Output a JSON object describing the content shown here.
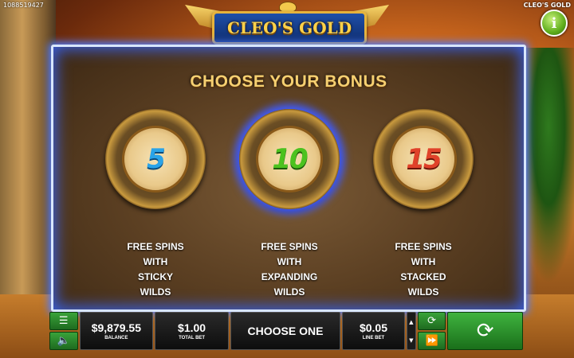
{
  "header": {
    "session_id": "1088519427",
    "game_name": "CLEO'S GOLD",
    "logo_text": "CLEO'S GOLD",
    "info_icon": "info-icon"
  },
  "bonus": {
    "title": "CHOOSE YOUR BONUS",
    "options": [
      {
        "spins": "5",
        "description": "FREE SPINS\nWITH\nSTICKY\nWILDS",
        "color": "#2aa3e8",
        "selected": false
      },
      {
        "spins": "10",
        "description": "FREE SPINS\nWITH\nEXPANDING\nWILDS",
        "color": "#4cc21f",
        "selected": true
      },
      {
        "spins": "15",
        "description": "FREE SPINS\nWITH\nSTACKED\nWILDS",
        "color": "#e0422a",
        "selected": false
      }
    ]
  },
  "bottom_bar": {
    "menu_icon": "hamburger-menu-icon",
    "sound_icon": "speaker-icon",
    "balance_value": "$9,879.55",
    "balance_label": "BALANCE",
    "total_bet_value": "$1.00",
    "total_bet_label": "TOTAL BET",
    "status_text": "CHOOSE ONE",
    "line_bet_value": "$0.05",
    "line_bet_label": "LINE BET",
    "autoplay_icon": "autoplay-icon",
    "turbo_icon": "fast-forward-icon",
    "spin_icon": "spin-refresh-icon"
  },
  "colors": {
    "panel_glow": "#4f7cff",
    "title_gold": "#f6d071",
    "button_green": "#2f8f2f"
  }
}
